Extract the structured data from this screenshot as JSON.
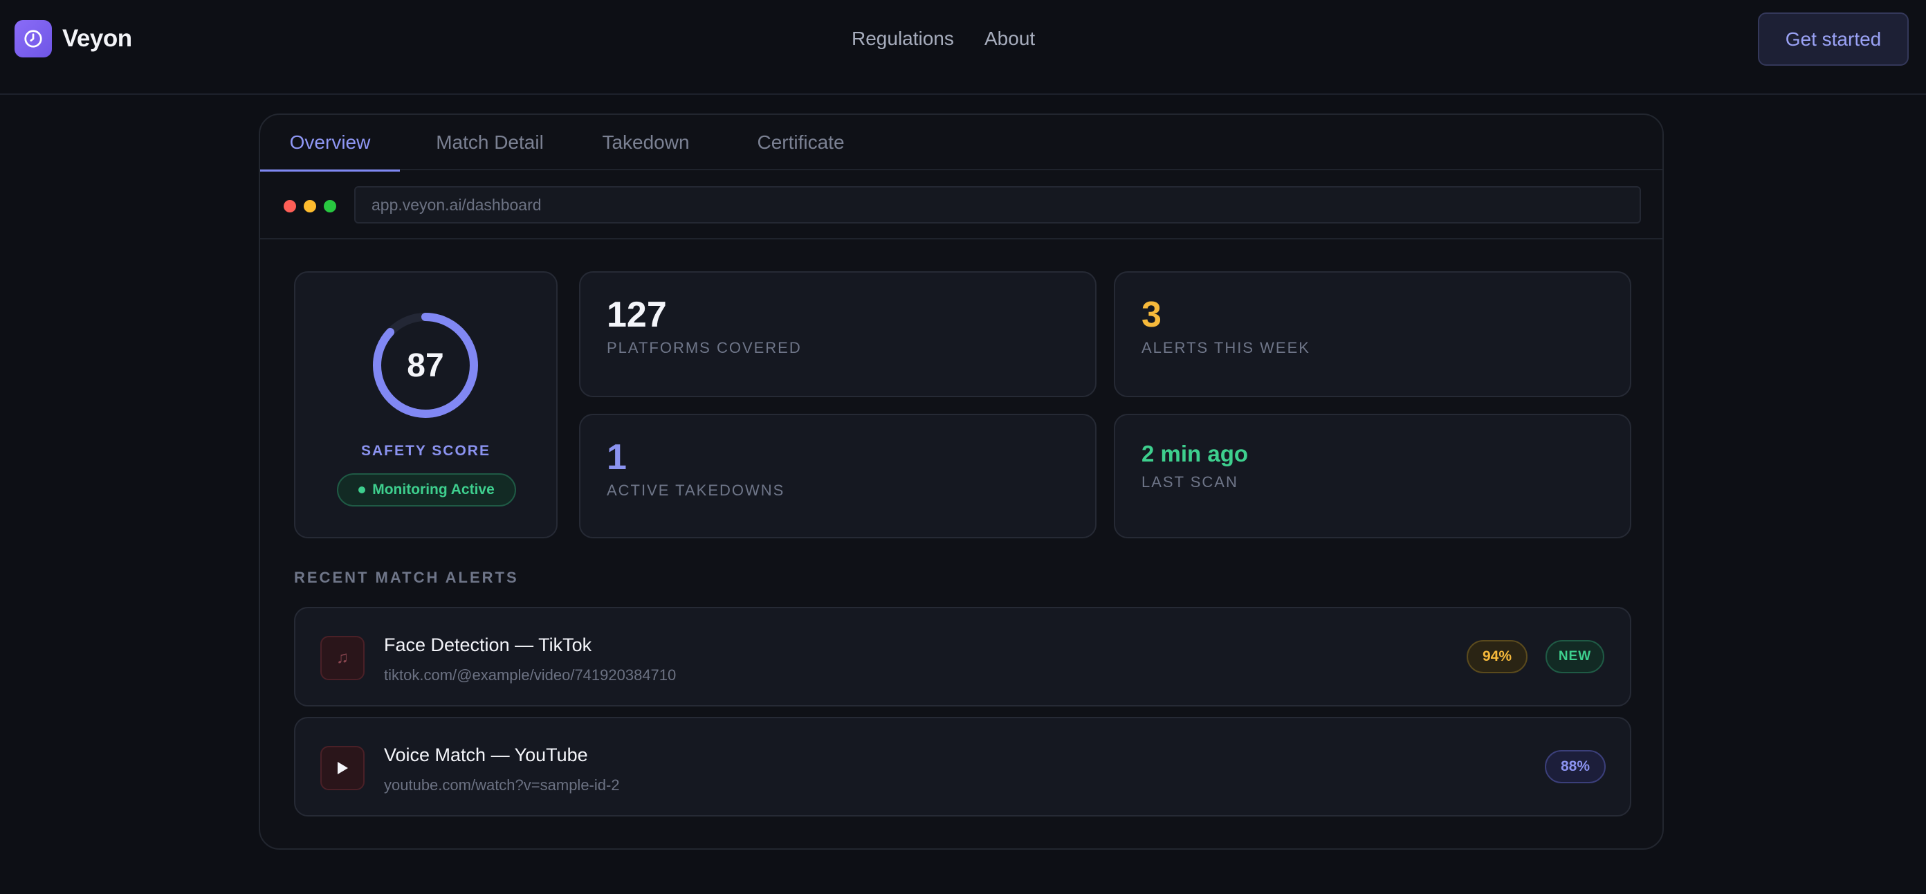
{
  "nav": {
    "brand": "Veyon",
    "links": [
      "Regulations",
      "About"
    ],
    "cta": "Get started"
  },
  "tabs": [
    "Overview",
    "Match Detail",
    "Takedown",
    "Certificate"
  ],
  "active_tab": "Overview",
  "browser": {
    "url": "app.veyon.ai/dashboard"
  },
  "score": {
    "value": "87",
    "fraction": 0.87,
    "label": "SAFETY SCORE",
    "status": "Monitoring Active"
  },
  "stats": [
    {
      "value": "127",
      "caption": "PLATFORMS COVERED",
      "color": "#f4f5fa"
    },
    {
      "value": "3",
      "caption": "ALERTS THIS WEEK",
      "color": "#f6b93b"
    },
    {
      "value": "1",
      "caption": "ACTIVE TAKEDOWNS",
      "color": "#8b93f0"
    },
    {
      "value": "2 min ago",
      "caption": "LAST SCAN",
      "color": "#3ecf8e"
    }
  ],
  "alerts_section": {
    "title": "RECENT MATCH ALERTS",
    "items": [
      {
        "title": "Face Detection — TikTok",
        "url": "tiktok.com/@example/video/741920384710",
        "confidence": "94%",
        "tag": "NEW",
        "icon": "music-note-icon"
      },
      {
        "title": "Voice Match — YouTube",
        "url": "youtube.com/watch?v=sample-id-2",
        "confidence": "88%",
        "icon": "play-icon"
      }
    ]
  },
  "colors": {
    "accent": "#8b93f0",
    "brand": "#7a5ef0",
    "success": "#3ecf8e",
    "warning": "#f6b93b"
  }
}
